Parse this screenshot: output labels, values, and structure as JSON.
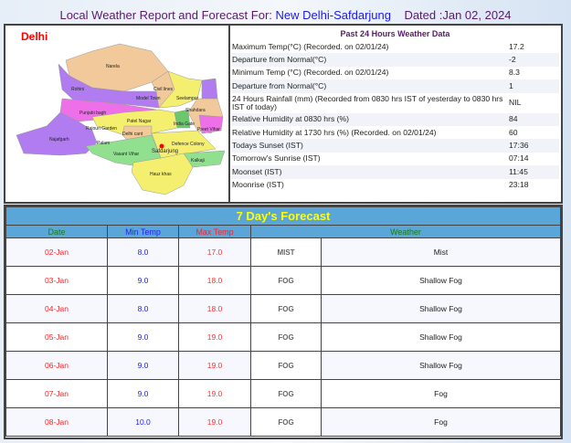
{
  "header": {
    "prefix": "Local Weather Report and Forecast For:",
    "location": "New Delhi-Safdarjung",
    "dated": "Dated :Jan 02, 2024"
  },
  "map": {
    "title": "Delhi",
    "labels": [
      "Narela",
      "Rohini",
      "Civil lines",
      "Model Town",
      "Seelampur",
      "Shahdara",
      "Punjabi bagh",
      "Patel Nagar",
      "Rajouri Garden",
      "Delhi cant",
      "Najafgarh",
      "Palam",
      "Vasant Vihar",
      "Safdarjung",
      "Hauz khas",
      "Kalkaji",
      "Defence Colony",
      "Preet Vihar",
      "India Gate"
    ]
  },
  "past24": {
    "title": "Past 24 Hours Weather Data",
    "rows": [
      {
        "label": "Maximum Temp(°C) (Recorded. on 02/01/24)",
        "value": "17.2"
      },
      {
        "label": "Departure from Normal(°C)",
        "value": "-2"
      },
      {
        "label": "Minimum Temp (°C) (Recorded. on 02/01/24)",
        "value": "8.3"
      },
      {
        "label": "Departure from Normal(°C)",
        "value": "1"
      },
      {
        "label": "24 Hours Rainfall (mm) (Recorded from 0830 hrs IST of yesterday to 0830 hrs IST of today)",
        "value": "NIL"
      },
      {
        "label": "Relative Humidity at 0830 hrs (%)",
        "value": "84"
      },
      {
        "label": "Relative Humidity at 1730 hrs (%) (Recorded. on 02/01/24)",
        "value": "60"
      },
      {
        "label": "Todays Sunset (IST)",
        "value": "17:36"
      },
      {
        "label": "Tomorrow's Sunrise (IST)",
        "value": "07:14"
      },
      {
        "label": "Moonset (IST)",
        "value": "11:45"
      },
      {
        "label": "Moonrise (IST)",
        "value": "23:18"
      }
    ]
  },
  "forecast": {
    "title": "7 Day's Forecast",
    "columns": [
      "Date",
      "Min Temp",
      "Max Temp",
      "Weather"
    ],
    "rows": [
      {
        "date": "02-Jan",
        "min": "8.0",
        "max": "17.0",
        "icon": "MIST",
        "weather": "Mist"
      },
      {
        "date": "03-Jan",
        "min": "9.0",
        "max": "18.0",
        "icon": "FOG",
        "weather": "Shallow Fog"
      },
      {
        "date": "04-Jan",
        "min": "8.0",
        "max": "18.0",
        "icon": "FOG",
        "weather": "Shallow Fog"
      },
      {
        "date": "05-Jan",
        "min": "9.0",
        "max": "19.0",
        "icon": "FOG",
        "weather": "Shallow Fog"
      },
      {
        "date": "06-Jan",
        "min": "9.0",
        "max": "19.0",
        "icon": "FOG",
        "weather": "Shallow Fog"
      },
      {
        "date": "07-Jan",
        "min": "9.0",
        "max": "19.0",
        "icon": "FOG",
        "weather": "Fog"
      },
      {
        "date": "08-Jan",
        "min": "10.0",
        "max": "19.0",
        "icon": "FOG",
        "weather": "Fog"
      }
    ]
  },
  "colors": {
    "header_bg": "#5ba6d8",
    "title_yellow": "#ffff00",
    "date": "#ff2222",
    "min": "#2222ff",
    "max": "#ff3333",
    "col_green": "#1a7a1a"
  }
}
